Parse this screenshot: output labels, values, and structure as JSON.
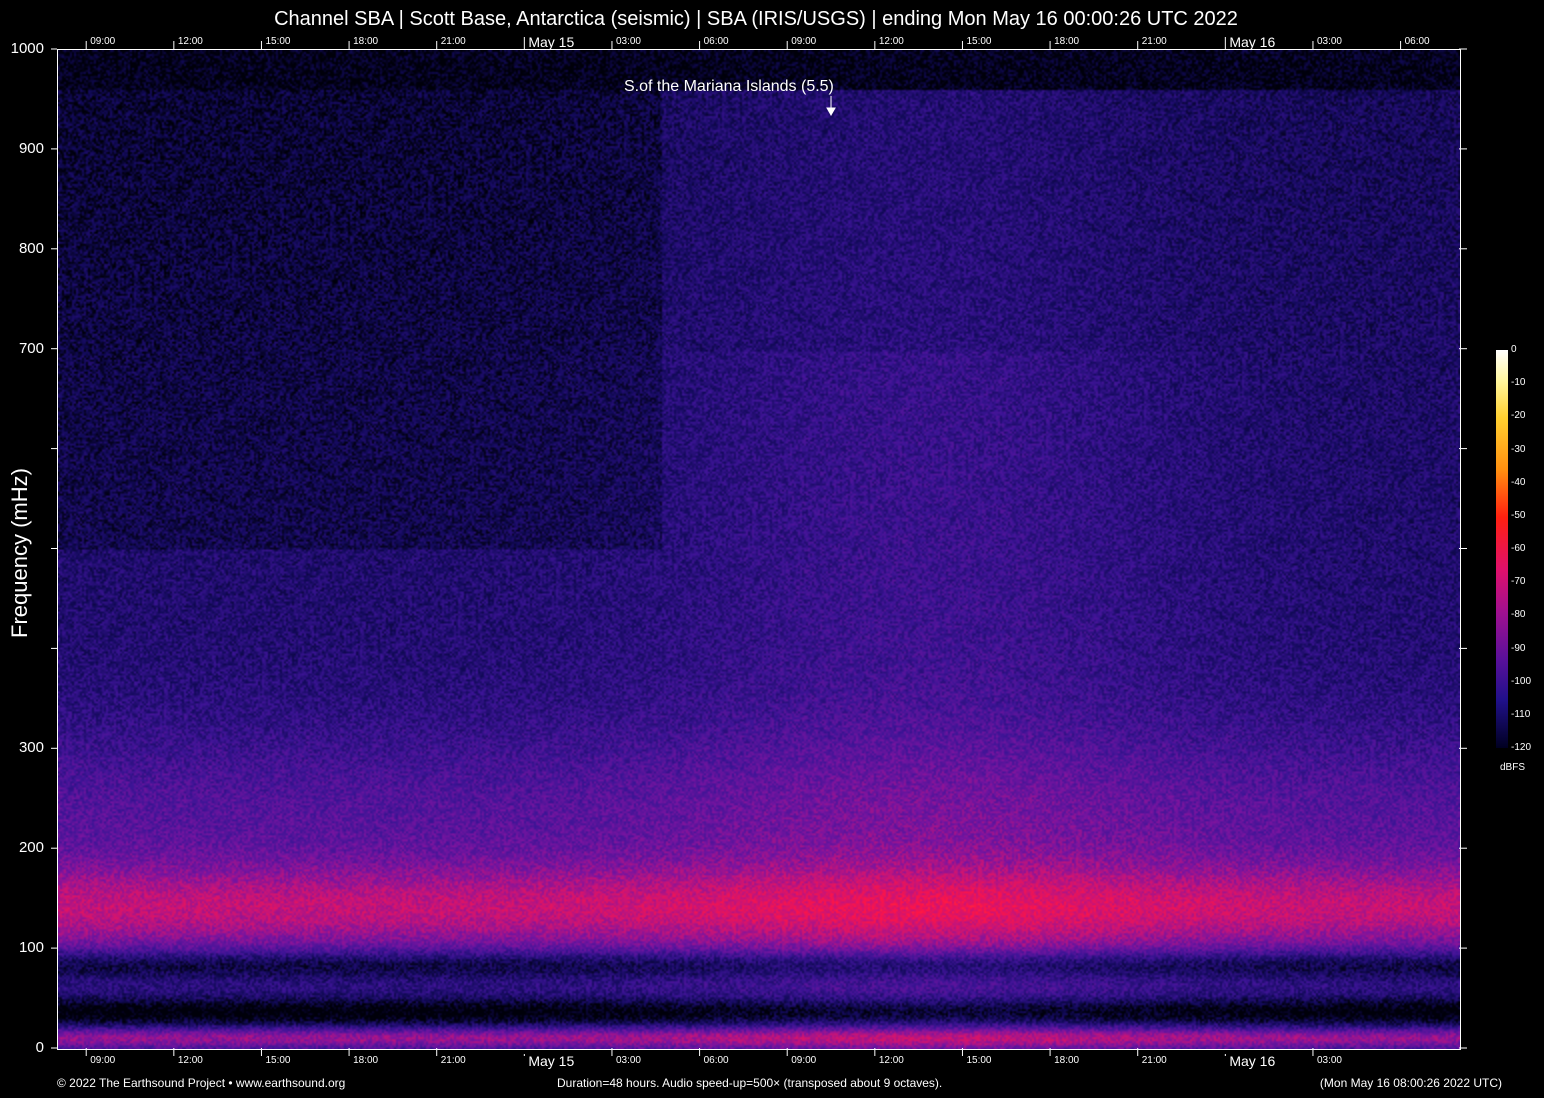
{
  "chart_data": {
    "type": "heatmap",
    "title": "Channel SBA | Scott Base, Antarctica (seismic) | SBA (IRIS/USGS) | ending Mon May 16 00:00:26 UTC 2022",
    "ylabel": "Frequency (mHz)",
    "ylim": [
      0,
      1000
    ],
    "y_ticks": [
      0,
      100,
      200,
      300,
      400,
      500,
      600,
      700,
      800,
      900,
      1000
    ],
    "y_tick_labels": [
      "0",
      "100",
      "200",
      "300",
      "",
      "",
      "",
      "700",
      "800",
      "900",
      "1000"
    ],
    "x_tick_labels_top": [
      "09:00",
      "12:00",
      "15:00",
      "18:00",
      "21:00",
      "May 15",
      "03:00",
      "06:00",
      "09:00",
      "12:00",
      "15:00",
      "18:00",
      "21:00",
      "May 16",
      "03:00",
      "06:00"
    ],
    "x_tick_labels_bottom": [
      "09:00",
      "12:00",
      "15:00",
      "18:00",
      "21:00",
      "May 15",
      "03:00",
      "06:00",
      "09:00",
      "12:00",
      "15:00",
      "18:00",
      "21:00",
      "May 16",
      "03:00"
    ],
    "colorbar": {
      "unit": "dBFS",
      "labels": [
        "0",
        "-10",
        "-20",
        "-30",
        "-40",
        "-50",
        "-60",
        "-70",
        "-80",
        "-90",
        "-100",
        "-110",
        "-120"
      ],
      "range": [
        -120,
        0
      ]
    },
    "annotations": [
      {
        "text": "S.of the Mariana Islands (5.5)",
        "x": "May 15 10:30"
      }
    ],
    "colors": {
      "background": "#000000",
      "low": "#10107a",
      "mid": "#8a1a9a",
      "high": "#ff1848"
    }
  },
  "footer": {
    "left": "© 2022 The Earthsound Project • www.earthsound.org",
    "middle": "Duration=48 hours. Audio speed-up=500× (transposed about 9 octaves).",
    "right": "(Mon May 16 08:00:26 2022 UTC)"
  }
}
